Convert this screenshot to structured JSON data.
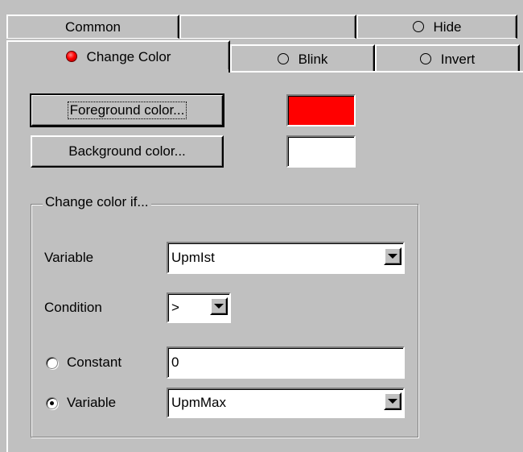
{
  "tabs_back": [
    {
      "label": "Common"
    },
    {
      "label": ""
    },
    {
      "label": "Hide",
      "icon": "radio-empty-icon"
    }
  ],
  "tabs_front": [
    {
      "label": "Change Color",
      "icon": "radio-red-icon",
      "active": true
    },
    {
      "label": "Blink",
      "icon": "radio-empty-icon"
    },
    {
      "label": "Invert",
      "icon": "radio-empty-icon"
    }
  ],
  "colors": {
    "foreground_label": "Foreground color...",
    "background_label": "Background color...",
    "foreground_value": "#ff0000",
    "background_value": "#ffffff"
  },
  "group": {
    "title": "Change color if...",
    "variable_label": "Variable",
    "variable_value": "UpmIst",
    "condition_label": "Condition",
    "condition_value": ">",
    "constant_label": "Constant",
    "constant_value": "0",
    "variable2_label": "Variable",
    "variable2_value": "UpmMax",
    "selected_source": "Variable"
  }
}
